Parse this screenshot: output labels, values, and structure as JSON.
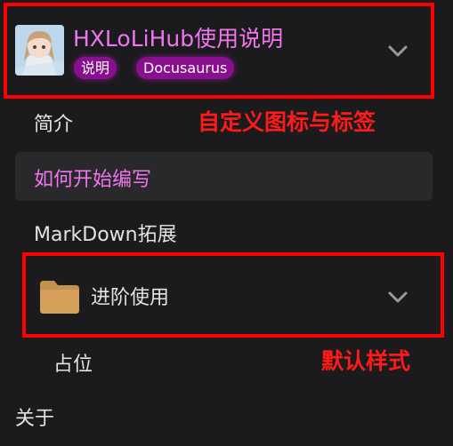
{
  "header": {
    "title": "HXLoLiHub使用说明",
    "badges": [
      "说明",
      "Docusaurus"
    ],
    "colors": {
      "title": "#f075ef",
      "badge_bg": "#8a0f8e"
    }
  },
  "sidebar": {
    "items": [
      {
        "label": "简介"
      },
      {
        "label": "如何开始编写",
        "active": true
      },
      {
        "label": "MarkDown拓展"
      },
      {
        "label": "进阶使用",
        "icon": "folder-icon"
      },
      {
        "label": "占位"
      },
      {
        "label": "关于"
      }
    ]
  },
  "annotations": {
    "custom_icon_tag": "自定义图标与标签",
    "default_style": "默认样式",
    "color": "#ff0000"
  }
}
